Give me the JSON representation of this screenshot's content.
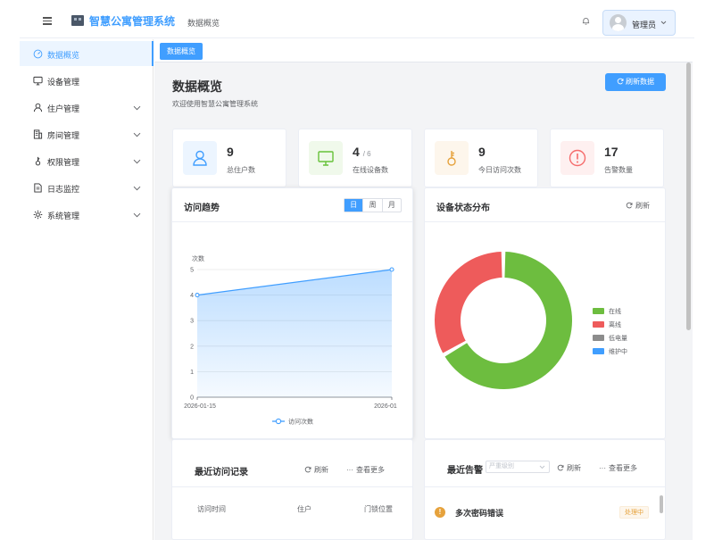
{
  "header": {
    "app_title": "智慧公寓管理系统",
    "breadcrumb": "数据概览",
    "user_name": "管理员"
  },
  "sidebar": {
    "items": [
      {
        "label": "数据概览",
        "icon": "dashboard-icon",
        "active": true,
        "has_children": false
      },
      {
        "label": "设备管理",
        "icon": "monitor-icon",
        "active": false,
        "has_children": false
      },
      {
        "label": "住户管理",
        "icon": "user-icon",
        "active": false,
        "has_children": true
      },
      {
        "label": "房间管理",
        "icon": "building-icon",
        "active": false,
        "has_children": true
      },
      {
        "label": "权限管理",
        "icon": "key-icon",
        "active": false,
        "has_children": true
      },
      {
        "label": "日志监控",
        "icon": "document-icon",
        "active": false,
        "has_children": true
      },
      {
        "label": "系统管理",
        "icon": "gear-icon",
        "active": false,
        "has_children": true
      }
    ]
  },
  "tabs": [
    "数据概览"
  ],
  "page": {
    "title": "数据概览",
    "subtitle": "欢迎使用智慧公寓管理系统",
    "refresh_label": "刷新数据"
  },
  "stats": [
    {
      "value": "9",
      "suffix": "",
      "label": "总住户数",
      "icon": "user-icon",
      "color": "#409eff",
      "bg": "#ecf5ff"
    },
    {
      "value": "4",
      "suffix": "/ 6",
      "label": "在线设备数",
      "icon": "monitor-icon",
      "color": "#67c23a",
      "bg": "#f0f9eb"
    },
    {
      "value": "9",
      "suffix": "",
      "label": "今日访问次数",
      "icon": "key-icon",
      "color": "#e6a23c",
      "bg": "#fdf6ec"
    },
    {
      "value": "17",
      "suffix": "",
      "label": "告警数量",
      "icon": "alert-icon",
      "color": "#f56c6c",
      "bg": "#fef0f0"
    }
  ],
  "visit_card": {
    "title": "访问趋势",
    "periods": [
      "日",
      "周",
      "月"
    ],
    "selected_period": "日"
  },
  "device_card": {
    "title": "设备状态分布",
    "refresh_label": "刷新"
  },
  "records_card": {
    "title": "最近访问记录",
    "refresh_label": "刷新",
    "more_label": "查看更多",
    "columns": [
      "访问时间",
      "住户",
      "门锁位置"
    ]
  },
  "alerts_card": {
    "title": "最近告警",
    "select_placeholder": "严重级别",
    "refresh_label": "刷新",
    "more_label": "查看更多",
    "first_alert": {
      "title": "多次密码错误",
      "status": "处理中"
    }
  },
  "chart_data": [
    {
      "type": "line",
      "ylabel": "次数",
      "x": [
        "2026-01-15",
        "2026-01"
      ],
      "ylim": [
        0,
        5
      ],
      "yticks": [
        0,
        1,
        2,
        3,
        4,
        5
      ],
      "series": [
        {
          "name": "访问次数",
          "values": [
            4,
            5
          ],
          "color": "#409eff"
        }
      ],
      "area": true,
      "legend_position": "bottom"
    },
    {
      "type": "pie",
      "donut": true,
      "categories": [
        "在线",
        "离线",
        "低电量",
        "维护中"
      ],
      "values": [
        4,
        2,
        0,
        0
      ],
      "colors": [
        "#6dbd3f",
        "#ee5b5b",
        "#8c8c8c",
        "#409eff"
      ],
      "legend_position": "right"
    }
  ]
}
